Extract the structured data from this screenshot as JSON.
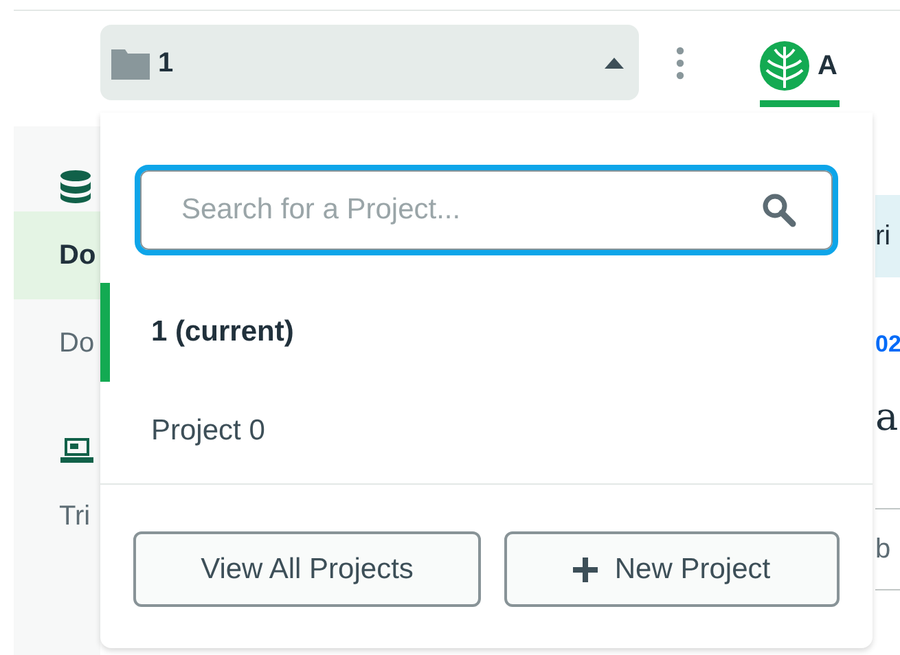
{
  "project_selector": {
    "value": "1",
    "expanded": true
  },
  "nav_tabs": [
    {
      "label": "A",
      "selected": true
    }
  ],
  "sidebar": {
    "sections": [
      {
        "items": [
          {
            "label": "Do",
            "selected": true
          },
          {
            "label": "Do",
            "selected": false
          }
        ]
      },
      {
        "items": [
          {
            "label": "Tri",
            "selected": false
          }
        ]
      }
    ]
  },
  "content": [
    {
      "kind": "tab",
      "text": "ri"
    },
    {
      "kind": "link",
      "text": "02"
    },
    {
      "kind": "heading",
      "text": "a"
    },
    {
      "kind": "field",
      "text": "b"
    }
  ],
  "project_menu": {
    "search": {
      "placeholder": "Search for a Project..."
    },
    "projects": [
      {
        "label": "1 (current)",
        "selected": true
      },
      {
        "label": "Project 0",
        "selected": false
      }
    ],
    "buttons": [
      {
        "label": "View All Projects",
        "kind": "plain"
      },
      {
        "label": "New Project",
        "kind": "add"
      }
    ]
  }
}
